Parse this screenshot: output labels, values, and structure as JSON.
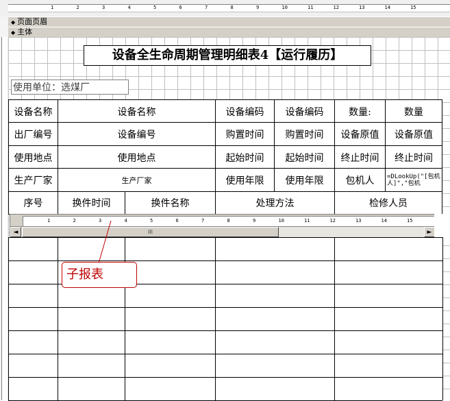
{
  "sections": {
    "page_header": "页面页眉",
    "detail": "主体"
  },
  "ruler_marks": [
    "1",
    "2",
    "3",
    "4",
    "5",
    "6",
    "7",
    "8",
    "9",
    "10",
    "11",
    "12",
    "13",
    "14",
    "15"
  ],
  "report": {
    "title": "设备全生命周期管理明细表4【运行履历】",
    "unit_label": "使用单位：选煤厂"
  },
  "rows": [
    [
      "设备名称",
      "设备名称",
      "设备编码",
      "设备编码",
      "数量:",
      "数量"
    ],
    [
      "出厂编号",
      "设备编号",
      "购置时间",
      "购置时间",
      "设备原值",
      "设备原值"
    ],
    [
      "使用地点",
      "使用地点",
      "起始时间",
      "起始时间",
      "终止时间",
      "终止时间"
    ],
    [
      "生产厂家",
      "生产厂家",
      "使用年限",
      "使用年限",
      "包机人",
      "=DLookUp(\"[包机人]\",\"包机"
    ]
  ],
  "subheaders": [
    "序号",
    "换件时间",
    "换件名称",
    "处理方法",
    "检修人员"
  ],
  "subreport": {
    "scroll_left": "◄",
    "scroll_right": "►",
    "thumb_grip": "III"
  },
  "callout_label": "子报表",
  "colors": {
    "callout": "#c00000",
    "grid": "#bfbfbf",
    "section_bar": "#d4d0c8"
  }
}
